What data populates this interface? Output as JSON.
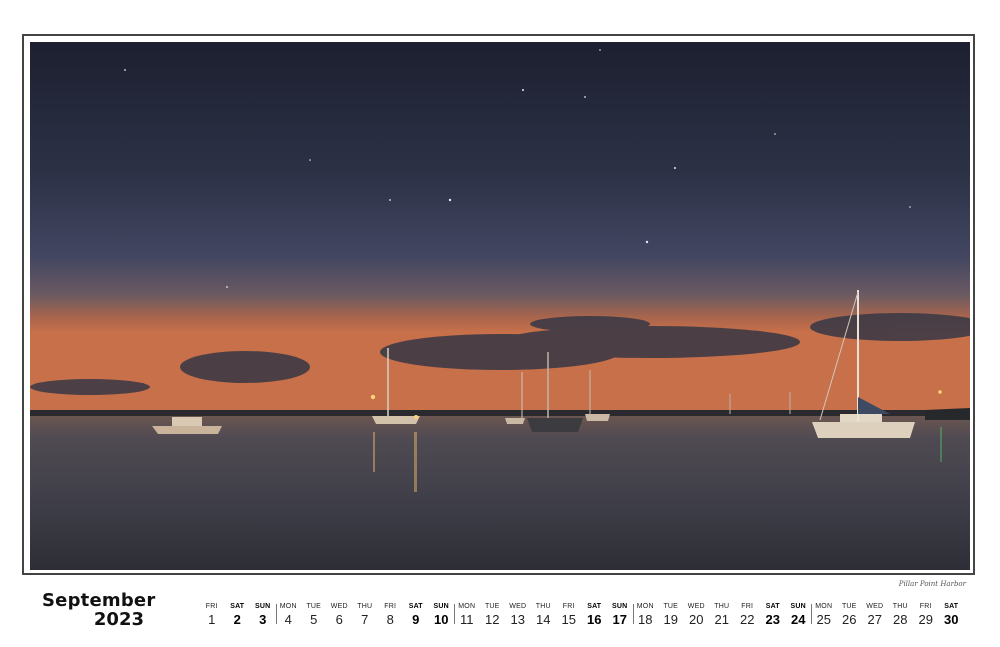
{
  "calendar": {
    "month": "September",
    "year": "2023",
    "caption": "Pillar Point Harbor",
    "days": [
      {
        "dow": "FRI",
        "num": "1",
        "weekend": false
      },
      {
        "dow": "SAT",
        "num": "2",
        "weekend": true
      },
      {
        "dow": "SUN",
        "num": "3",
        "weekend": true
      },
      {
        "dow": "MON",
        "num": "4",
        "weekend": false
      },
      {
        "dow": "TUE",
        "num": "5",
        "weekend": false
      },
      {
        "dow": "WED",
        "num": "6",
        "weekend": false
      },
      {
        "dow": "THU",
        "num": "7",
        "weekend": false
      },
      {
        "dow": "FRI",
        "num": "8",
        "weekend": false
      },
      {
        "dow": "SAT",
        "num": "9",
        "weekend": true
      },
      {
        "dow": "SUN",
        "num": "10",
        "weekend": true
      },
      {
        "dow": "MON",
        "num": "11",
        "weekend": false
      },
      {
        "dow": "TUE",
        "num": "12",
        "weekend": false
      },
      {
        "dow": "WED",
        "num": "13",
        "weekend": false
      },
      {
        "dow": "THU",
        "num": "14",
        "weekend": false
      },
      {
        "dow": "FRI",
        "num": "15",
        "weekend": false
      },
      {
        "dow": "SAT",
        "num": "16",
        "weekend": true
      },
      {
        "dow": "SUN",
        "num": "17",
        "weekend": true
      },
      {
        "dow": "MON",
        "num": "18",
        "weekend": false
      },
      {
        "dow": "TUE",
        "num": "19",
        "weekend": false
      },
      {
        "dow": "WED",
        "num": "20",
        "weekend": false
      },
      {
        "dow": "THU",
        "num": "21",
        "weekend": false
      },
      {
        "dow": "FRI",
        "num": "22",
        "weekend": false
      },
      {
        "dow": "SAT",
        "num": "23",
        "weekend": true
      },
      {
        "dow": "SUN",
        "num": "24",
        "weekend": true
      },
      {
        "dow": "MON",
        "num": "25",
        "weekend": false
      },
      {
        "dow": "TUE",
        "num": "26",
        "weekend": false
      },
      {
        "dow": "WED",
        "num": "27",
        "weekend": false
      },
      {
        "dow": "THU",
        "num": "28",
        "weekend": false
      },
      {
        "dow": "FRI",
        "num": "29",
        "weekend": false
      },
      {
        "dow": "SAT",
        "num": "30",
        "weekend": true
      }
    ]
  },
  "photo": {
    "subject": "harbor-at-dusk-with-moored-sailboats",
    "colors": {
      "sky_top": "#1e2232",
      "sky_mid": "#3a3f56",
      "sky_glow": "#c7704a",
      "water": "#4a4a52",
      "clouds": "#3b3c48"
    }
  }
}
